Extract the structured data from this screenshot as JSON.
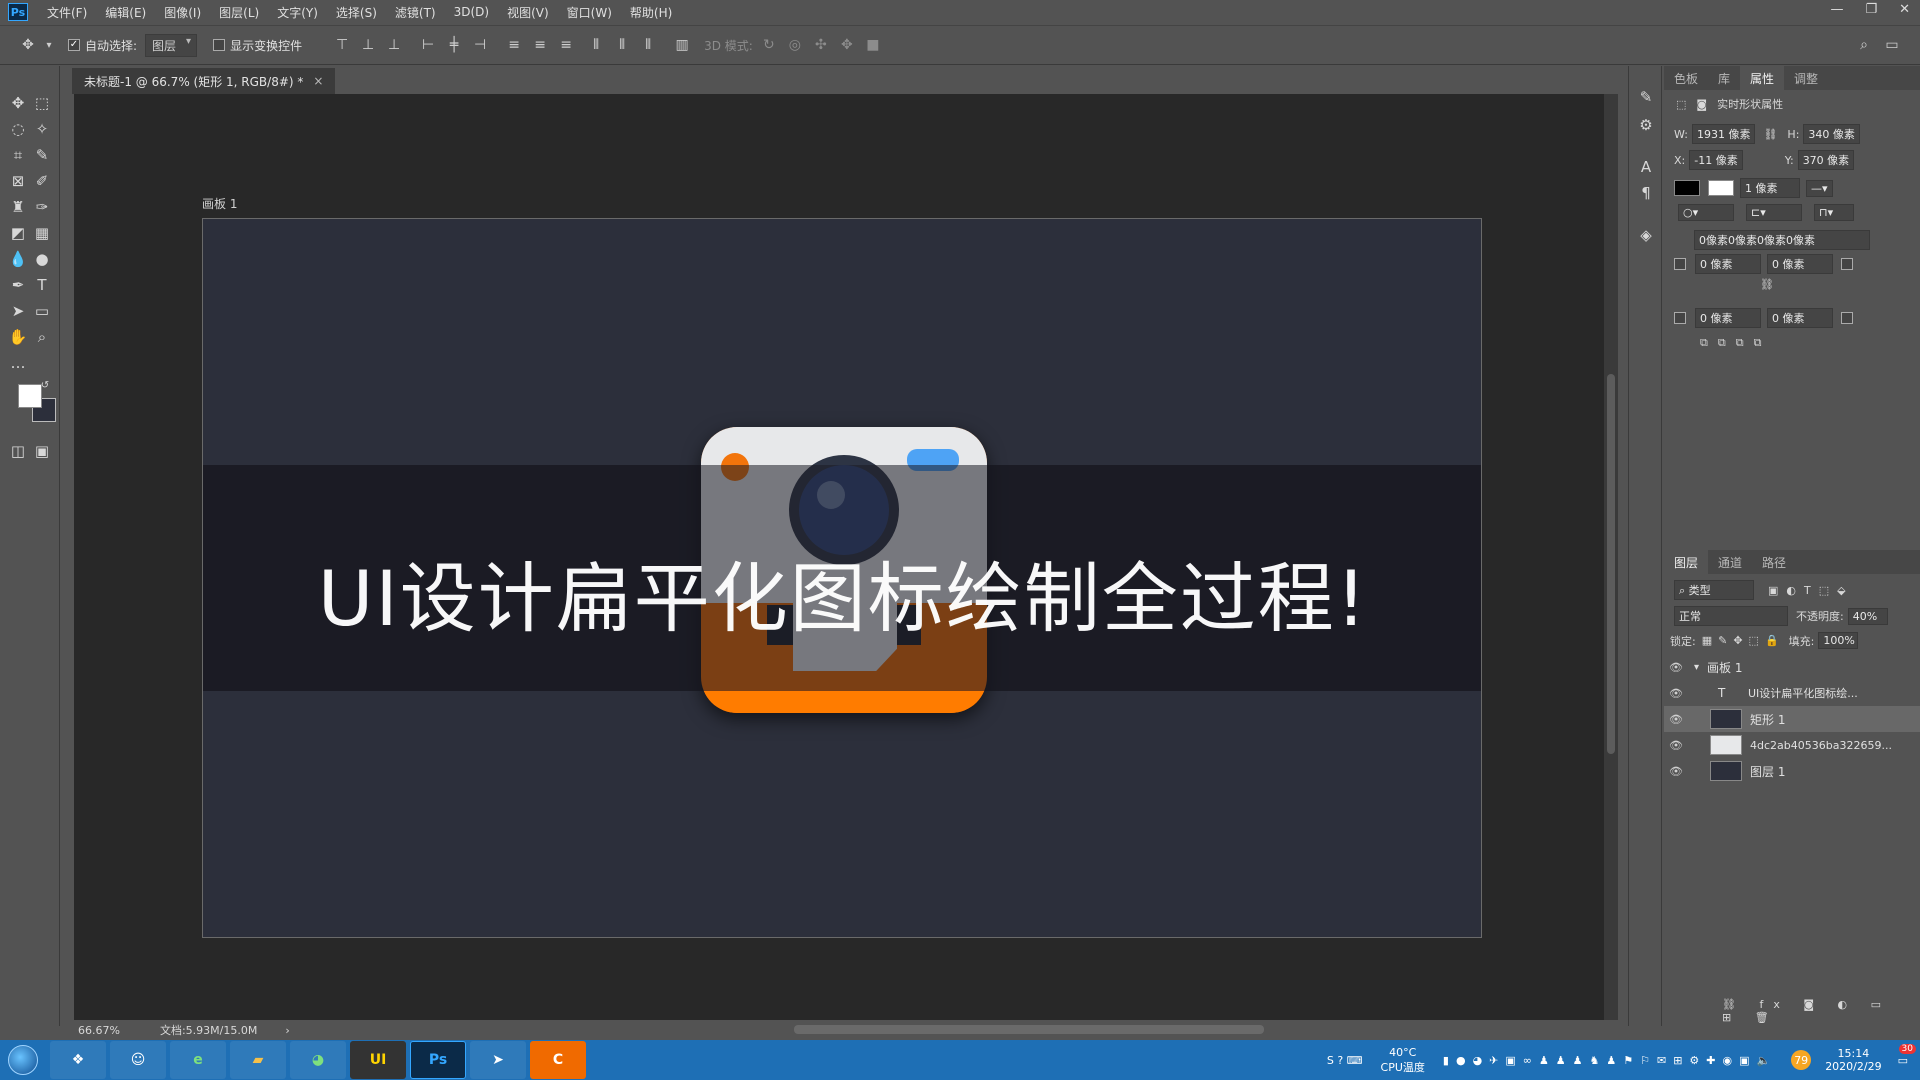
{
  "menubar": {
    "items": [
      "文件(F)",
      "编辑(E)",
      "图像(I)",
      "图层(L)",
      "文字(Y)",
      "选择(S)",
      "滤镜(T)",
      "3D(D)",
      "视图(V)",
      "窗口(W)",
      "帮助(H)"
    ],
    "logo": "Ps"
  },
  "options": {
    "auto_select_label": "自动选择:",
    "auto_select_value": "图层",
    "show_transform_label": "显示变换控件",
    "mode_3d_label": "3D 模式:"
  },
  "document": {
    "tab_title": "未标题-1 @ 66.7% (矩形 1, RGB/8#) *",
    "artboard_label": "画板 1",
    "headline": "UI设计扁平化图标绘制全过程!"
  },
  "status": {
    "zoom": "66.67%",
    "doc_info": "文档:5.93M/15.0M"
  },
  "properties": {
    "tabs": [
      "色板",
      "库",
      "属性",
      "调整"
    ],
    "active_tab": "属性",
    "section_title": "实时形状属性",
    "w_label": "W:",
    "w_value": "1931 像素",
    "h_label": "H:",
    "h_value": "340 像素",
    "x_label": "X:",
    "x_value": "-11 像素",
    "y_label": "Y:",
    "y_value": "370 像素",
    "stroke_width": "1 像素",
    "corner_all": "0像素0像素0像素0像素",
    "corner_tl": "0 像素",
    "corner_tr": "0 像素",
    "corner_bl": "0 像素",
    "corner_br": "0 像素"
  },
  "layers_panel": {
    "tabs": [
      "图层",
      "通道",
      "路径"
    ],
    "filter_label": "类型",
    "blend_mode": "正常",
    "opacity_label": "不透明度:",
    "opacity_value": "40%",
    "lock_label": "锁定:",
    "fill_label": "填充:",
    "fill_value": "100%",
    "layers": [
      {
        "name": "画板 1",
        "type": "artboard"
      },
      {
        "name": "UI设计扁平化图标绘...",
        "type": "text"
      },
      {
        "name": "矩形 1",
        "type": "shape",
        "selected": true
      },
      {
        "name": "4dc2ab40536ba322659...",
        "type": "image"
      },
      {
        "name": "图层 1",
        "type": "fill"
      }
    ]
  },
  "taskbar": {
    "apps": [
      "UI",
      "Ps"
    ],
    "temp": "40°C",
    "cpu_label": "CPU温度",
    "time": "15:14",
    "date": "2020/2/29",
    "badge": "79",
    "notif": "30"
  },
  "colors": {
    "accent": "#f06a00",
    "flash_blue": "#4ea3f5",
    "artboard_bg": "#2c2f3b",
    "taskbar": "#1e6fb5"
  }
}
